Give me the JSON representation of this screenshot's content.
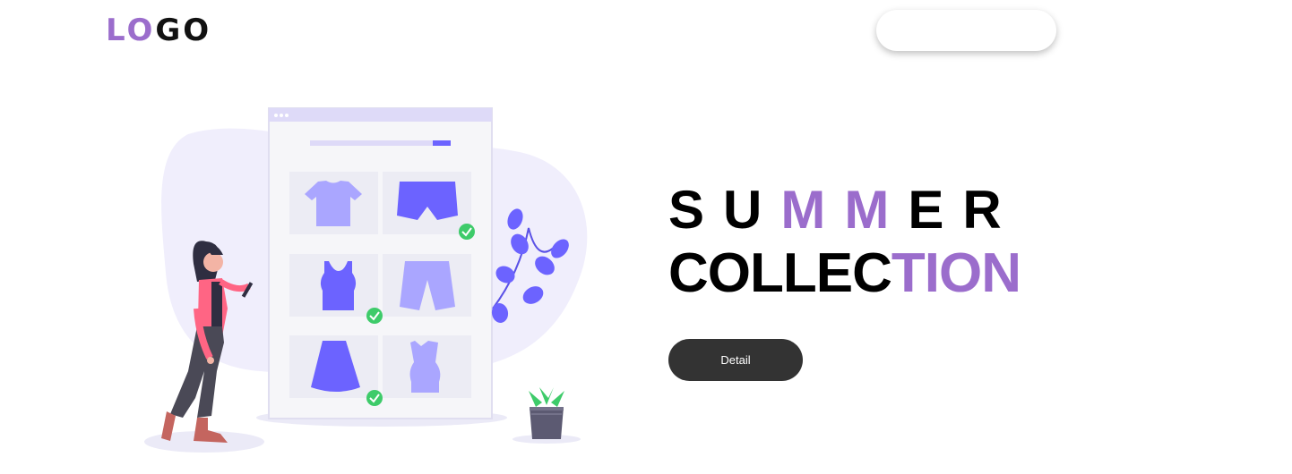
{
  "header": {
    "logo_part_accent": "LO",
    "logo_part_dark": "GO",
    "search_value": ""
  },
  "hero": {
    "title_line1_dark_a": "SU",
    "title_line1_purple": "MM",
    "title_line1_dark_b": "ER",
    "title_line2_dark": "COLLEC",
    "title_line2_purple": "TION",
    "detail_button_label": "Detail"
  },
  "colors": {
    "accent_purple": "#9b6dcc",
    "button_dark": "#333333",
    "illustration_blob": "#f0eefc",
    "clothing_primary": "#6c63ff",
    "clothing_light": "#aaa6ff",
    "check_green": "#3ecb6a"
  },
  "illustration": {
    "icons": [
      "t-shirt-icon",
      "shorts-icon",
      "tank-top-icon",
      "pants-icon",
      "skirt-icon",
      "vest-icon"
    ]
  }
}
